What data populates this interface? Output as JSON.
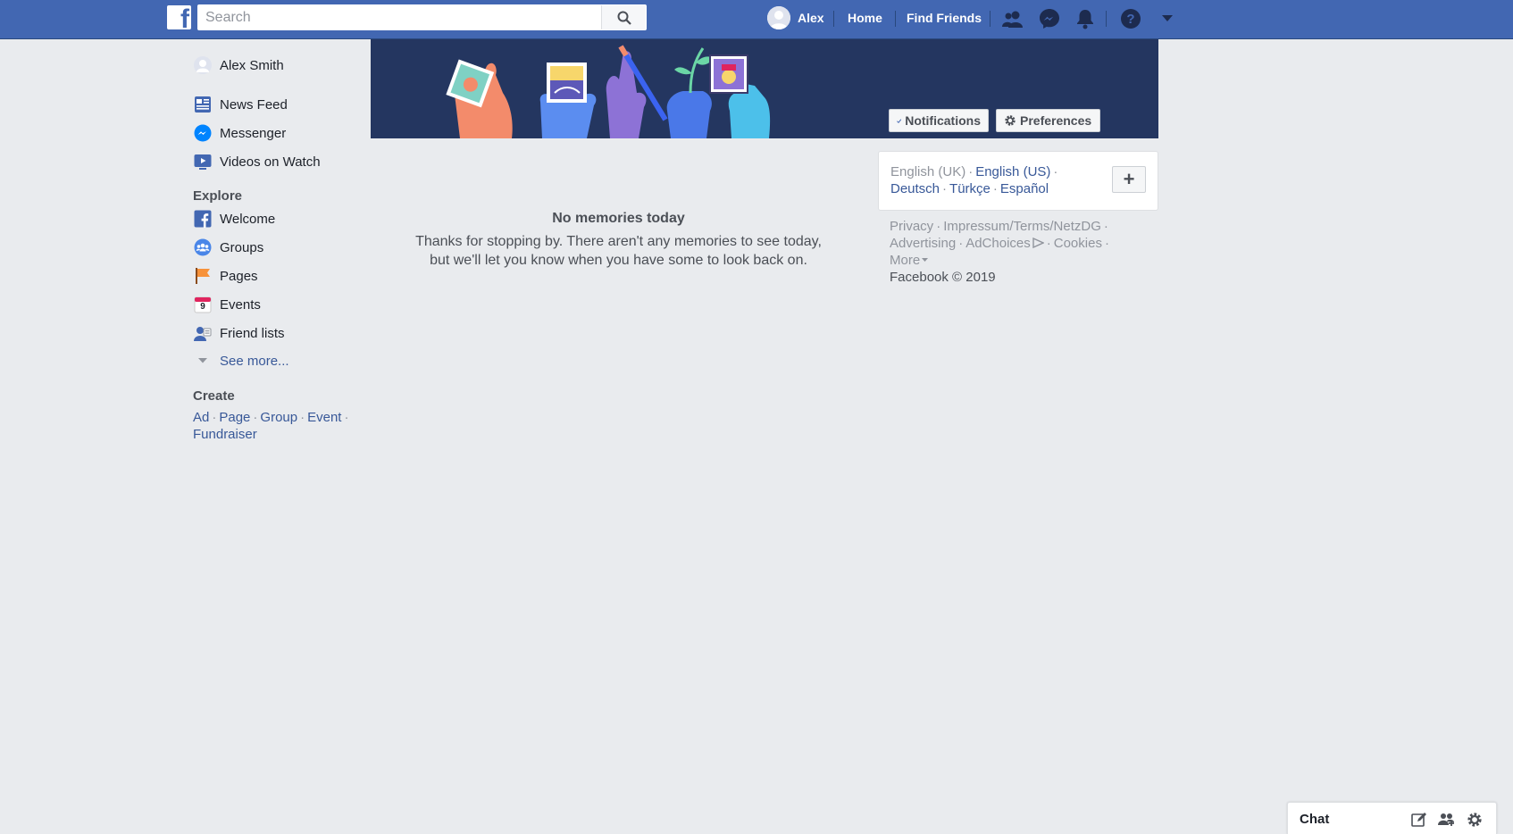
{
  "header": {
    "logo_letter": "f",
    "search_placeholder": "Search",
    "profile_name": "Alex",
    "home_label": "Home",
    "find_friends_label": "Find Friends",
    "icons": [
      "friend-requests-icon",
      "messenger-icon",
      "notifications-icon",
      "help-icon",
      "dropdown-icon"
    ]
  },
  "sidebar": {
    "profile": "Alex Smith",
    "main_items": [
      {
        "label": "News Feed",
        "icon": "news-feed-icon"
      },
      {
        "label": "Messenger",
        "icon": "messenger-icon"
      },
      {
        "label": "Videos on Watch",
        "icon": "watch-icon"
      }
    ],
    "explore_header": "Explore",
    "explore_items": [
      {
        "label": "Welcome",
        "icon": "facebook-icon"
      },
      {
        "label": "Groups",
        "icon": "groups-icon"
      },
      {
        "label": "Pages",
        "icon": "flag-icon"
      },
      {
        "label": "Events",
        "icon": "calendar-icon"
      },
      {
        "label": "Friend lists",
        "icon": "friend-list-icon"
      }
    ],
    "see_more": "See more...",
    "create_header": "Create",
    "create_links": [
      "Ad",
      "Page",
      "Group",
      "Event",
      "Fundraiser"
    ],
    "event_calendar_day": "9"
  },
  "banner": {
    "notifications_label": "Notifications",
    "preferences_label": "Preferences"
  },
  "memories": {
    "title": "No memories today",
    "line1": "Thanks for stopping by. There aren't any memories to see today,",
    "line2": "but we'll let you know when you have some to look back on."
  },
  "languages": {
    "current": "English (UK)",
    "options": [
      "English (US)",
      "Deutsch",
      "Türkçe",
      "Español"
    ],
    "add_symbol": "+"
  },
  "footer": {
    "links": [
      "Privacy",
      "Impressum/Terms/NetzDG",
      "Advertising",
      "AdChoices",
      "Cookies",
      "More"
    ],
    "copyright": "Facebook © 2019"
  },
  "chat": {
    "label": "Chat"
  },
  "colors": {
    "brand_blue": "#4267b2",
    "link_blue": "#385898",
    "background": "#e9ebee",
    "banner_navy": "#243660"
  }
}
